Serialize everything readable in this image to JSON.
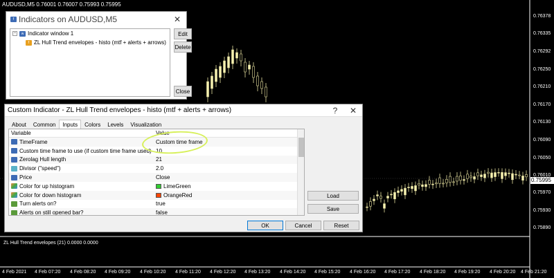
{
  "chart_header": "AUDUSD,M5  0.76001 0.76007 0.75993 0.75995",
  "current_price": "0.75995",
  "y_axis": [
    "0.76378",
    "0.76335",
    "0.76292",
    "0.76250",
    "0.76210",
    "0.76170",
    "0.76130",
    "0.76090",
    "0.76050",
    "0.76010",
    "0.75970",
    "0.75930",
    "0.75890"
  ],
  "x_axis": [
    "4 Feb 2021",
    "4 Feb 07:20",
    "4 Feb 08:20",
    "4 Feb 09:20",
    "4 Feb 10:20",
    "4 Feb 11:20",
    "4 Feb 12:20",
    "4 Feb 13:20",
    "4 Feb 14:20",
    "4 Feb 15:20",
    "4 Feb 16:20",
    "4 Feb 17:20",
    "4 Feb 18:20",
    "4 Feb 19:20",
    "4 Feb 20:20",
    "4 Feb 21:20"
  ],
  "subwindow_label": "ZL Hull Trend envelopes (21) 0.0000 0.0000",
  "indicators_dialog": {
    "title": "Indicators on AUDUSD,M5",
    "tree_root": "Indicator window 1",
    "tree_child": "ZL Hull Trend envelopes - histo (mtf + alerts + arrows)",
    "edit_label": "Edit",
    "delete_label": "Delete",
    "close_label": "Close",
    "close_x": "✕"
  },
  "custom_dialog": {
    "title": "Custom Indicator - ZL Hull Trend envelopes - histo (mtf + alerts + arrows)",
    "help": "?",
    "close_x": "✕",
    "tabs": [
      "About",
      "Common",
      "Inputs",
      "Colors",
      "Levels",
      "Visualization"
    ],
    "col_variable": "Variable",
    "col_value": "Value",
    "rows": [
      {
        "icon": "123",
        "var": "TimeFrame",
        "value": "Custom time frame"
      },
      {
        "icon": "123",
        "var": "Custom time frame to use (if custom time frame used)",
        "value": "10"
      },
      {
        "icon": "123",
        "var": "Zerolag Hull length",
        "value": "21"
      },
      {
        "icon": "½",
        "var": "Divisor (\"speed\")",
        "value": "2.0"
      },
      {
        "icon": "123",
        "var": "Price",
        "value": "Close"
      },
      {
        "icon": "col",
        "var": "Color for up histogram",
        "value": "LimeGreen",
        "swatch": "#32cd32"
      },
      {
        "icon": "col",
        "var": "Color for down histogram",
        "value": "OrangeRed",
        "swatch": "#ff4500"
      },
      {
        "icon": "bool",
        "var": "Turn alerts on?",
        "value": "true"
      },
      {
        "icon": "bool",
        "var": "Alerts on still opened bar?",
        "value": "false"
      }
    ],
    "load_label": "Load",
    "save_label": "Save",
    "ok_label": "OK",
    "cancel_label": "Cancel",
    "reset_label": "Reset"
  },
  "colors": {
    "bull": "#f5f0b0",
    "bear": "#f5f0b0",
    "annotation": "#d7f05a"
  }
}
